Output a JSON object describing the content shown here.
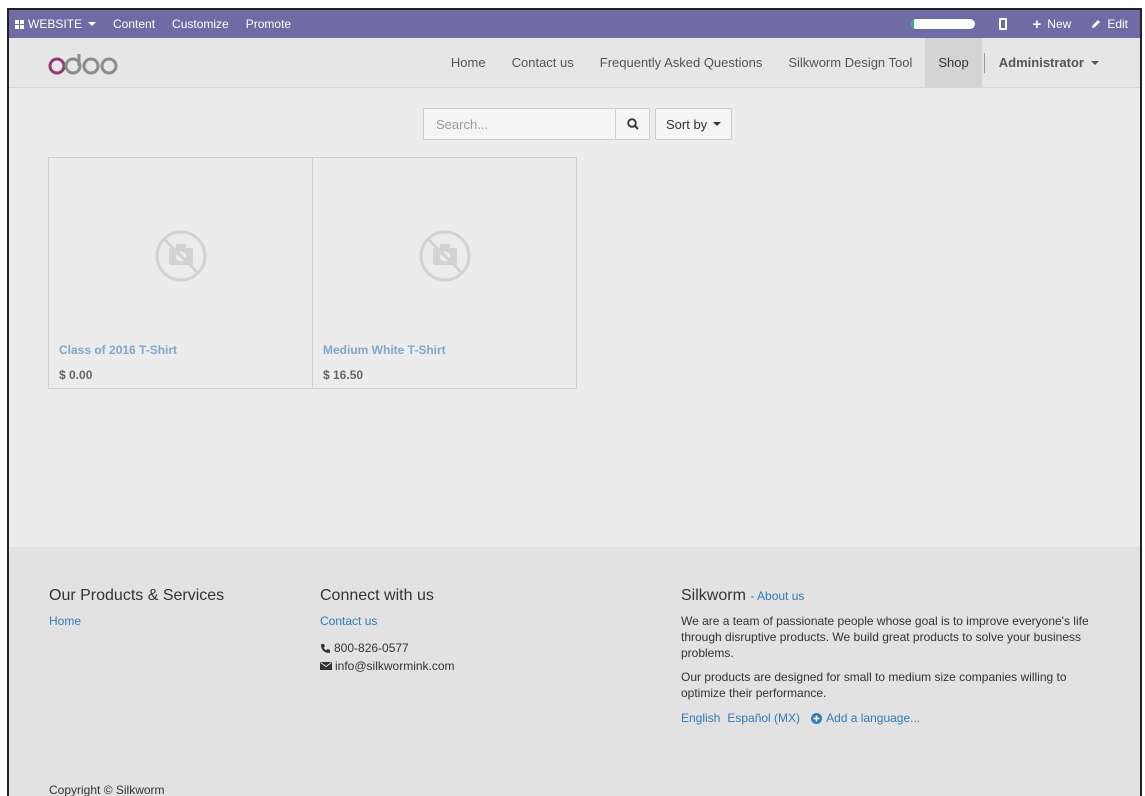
{
  "adminbar": {
    "website_label": "WEBSITE",
    "menu": [
      "Content",
      "Customize",
      "Promote"
    ],
    "progress_percent": 6,
    "new_label": "New",
    "edit_label": "Edit",
    "bg_color": "#6f6ba5"
  },
  "navbar": {
    "logo_text": "odoo",
    "items": [
      "Home",
      "Contact us",
      "Frequently Asked Questions",
      "Silkworm Design Tool",
      "Shop"
    ],
    "active_item": "Shop",
    "user": "Administrator"
  },
  "search": {
    "placeholder": "Search...",
    "sort_label": "Sort by"
  },
  "products": [
    {
      "name": "Class of 2016 T-Shirt",
      "price": "$ 0.00"
    },
    {
      "name": "Medium White T-Shirt",
      "price": "$ 16.50"
    }
  ],
  "footer": {
    "col1": {
      "title": "Our Products & Services",
      "links": [
        "Home"
      ]
    },
    "col2": {
      "title": "Connect with us",
      "link": "Contact us",
      "phone": "800-826-0577",
      "email": "info@silkwormink.com"
    },
    "col3": {
      "title": "Silkworm",
      "about": "About us",
      "para1": "We are a team of passionate people whose goal is to improve everyone's life through disruptive products. We build great products to solve your business problems.",
      "para2": "Our products are designed for small to medium size companies willing to optimize their performance.",
      "languages": [
        "English",
        "Español (MX)"
      ],
      "add_language": "Add a language..."
    },
    "copyright": "Copyright © Silkworm"
  }
}
